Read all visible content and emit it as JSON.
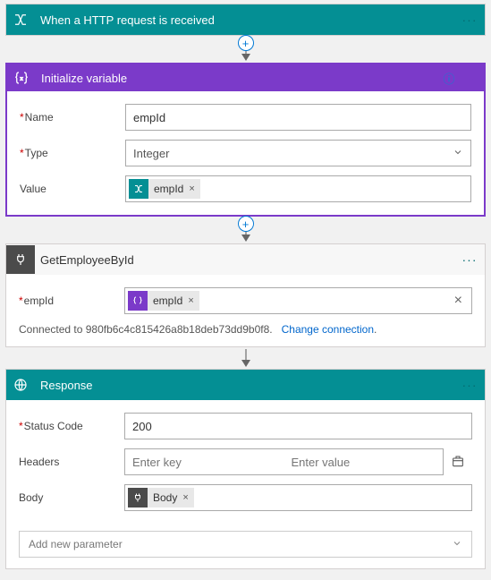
{
  "trigger": {
    "title": "When a HTTP request is received"
  },
  "initVar": {
    "title": "Initialize variable",
    "nameLabel": "Name",
    "nameValue": "empId",
    "typeLabel": "Type",
    "typeValue": "Integer",
    "valueLabel": "Value",
    "tokenName": "empId"
  },
  "getEmp": {
    "title": "GetEmployeeById",
    "fieldLabel": "empId",
    "tokenName": "empId",
    "connText": "Connected to 980fb6c4c815426a8b18deb73dd9b0f8.",
    "changeText": "Change connection"
  },
  "response": {
    "title": "Response",
    "statusLabel": "Status Code",
    "statusValue": "200",
    "headersLabel": "Headers",
    "headerKeyPh": "Enter key",
    "headerValPh": "Enter value",
    "bodyLabel": "Body",
    "bodyToken": "Body",
    "addParam": "Add new parameter"
  },
  "glyph": {
    "ellipsis": "···",
    "plus": "+",
    "x": "×",
    "info": "ⓘ"
  }
}
